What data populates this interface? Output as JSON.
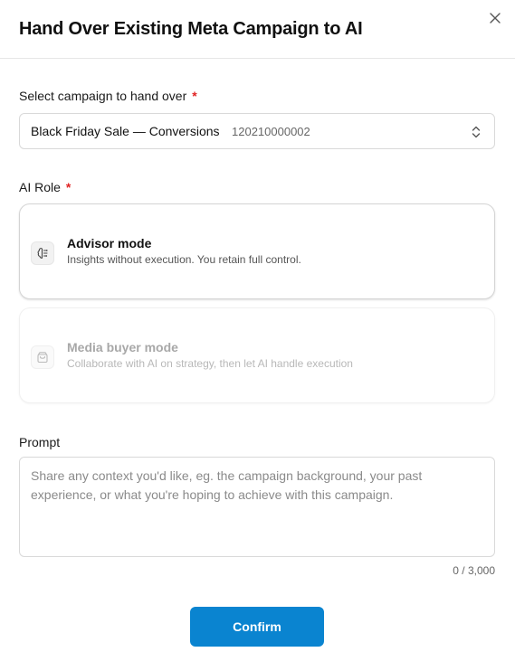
{
  "dialog": {
    "title": "Hand Over Existing Meta Campaign to AI",
    "close_icon": "close-icon"
  },
  "campaign": {
    "label": "Select campaign to hand over",
    "required_mark": "*",
    "selected_name": "Black Friday Sale — Conversions",
    "selected_id": "120210000002",
    "chevron_icon": "chevron-up-down-icon"
  },
  "ai_role": {
    "label": "AI Role",
    "required_mark": "*",
    "options": [
      {
        "title": "Advisor mode",
        "description": "Insights without execution. You retain full control.",
        "icon": "brain-icon",
        "state": "selectable"
      },
      {
        "title": "Media buyer mode",
        "description": "Collaborate with AI on strategy, then let AI handle execution",
        "icon": "shopping-bag-icon",
        "state": "disabled"
      }
    ]
  },
  "prompt": {
    "label": "Prompt",
    "value": "",
    "placeholder": "Share any context you'd like, eg. the campaign background, your past experience, or what you're hoping to achieve with this campaign.",
    "counter": "0 / 3,000"
  },
  "actions": {
    "confirm_label": "Confirm"
  },
  "colors": {
    "primary": "#0a84d0",
    "required": "#e02424"
  }
}
